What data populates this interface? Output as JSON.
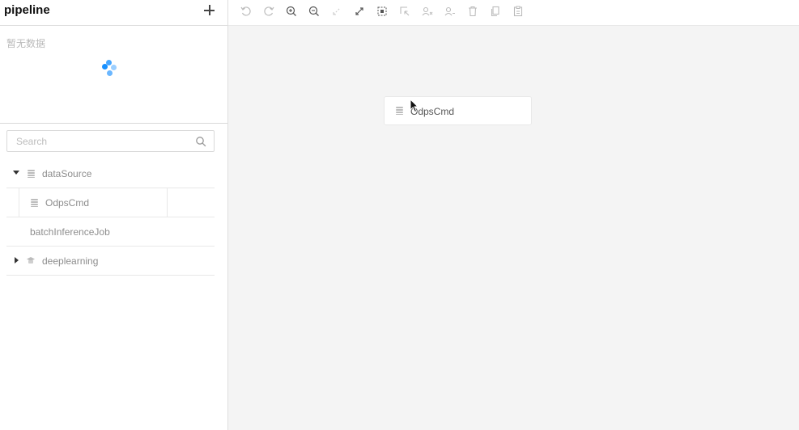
{
  "sidebar": {
    "title": "pipeline",
    "add_icon": "plus-icon",
    "empty_text": "暂无数据",
    "search": {
      "placeholder": "Search",
      "value": ""
    },
    "tree": [
      {
        "label": "dataSource",
        "expanded": true,
        "icon": "database-icon",
        "children": [
          {
            "label": "OdpsCmd",
            "icon": "database-icon"
          }
        ]
      },
      {
        "label": "batchInferenceJob"
      },
      {
        "label": "deeplearning",
        "expanded": false,
        "icon": "hat-icon"
      }
    ]
  },
  "toolbar": {
    "icons": [
      "undo-icon",
      "redo-icon",
      "zoom-in-icon",
      "zoom-out-icon",
      "shrink-icon",
      "expand-icon",
      "select-all-icon",
      "select-area-icon",
      "group-icon",
      "ungroup-icon",
      "delete-icon",
      "copy-icon",
      "paste-icon"
    ]
  },
  "canvas": {
    "nodes": [
      {
        "label": "OdpsCmd",
        "icon": "database-icon"
      }
    ]
  },
  "colors": {
    "accent": "#1890ff",
    "canvas_bg": "#f4f4f4"
  }
}
